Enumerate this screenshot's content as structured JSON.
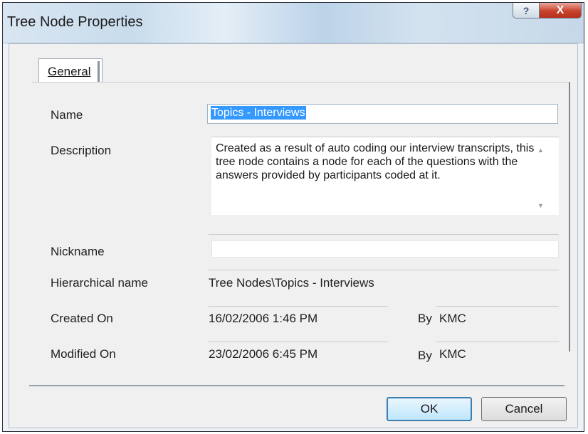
{
  "window": {
    "title": "Tree Node Properties",
    "help_label": "?",
    "close_label": "X"
  },
  "tabs": [
    {
      "label": "General",
      "selected": true
    }
  ],
  "fields": {
    "name": {
      "label": "Name",
      "value": "Topics - Interviews"
    },
    "description": {
      "label": "Description",
      "value": "Created as a result of auto coding our interview transcripts, this tree node contains a node for each of the questions with the answers provided by participants coded at it."
    },
    "nickname": {
      "label": "Nickname",
      "value": ""
    },
    "hierarchical_name": {
      "label": "Hierarchical name",
      "value": "Tree Nodes\\Topics - Interviews"
    },
    "created_on": {
      "label": "Created On",
      "value": "16/02/2006 1:46 PM",
      "by_label": "By",
      "by_value": "KMC"
    },
    "modified_on": {
      "label": "Modified On",
      "value": "23/02/2006 6:45 PM",
      "by_label": "By",
      "by_value": "KMC"
    }
  },
  "buttons": {
    "ok": "OK",
    "cancel": "Cancel"
  },
  "colors": {
    "selection": "#3399ff",
    "close_button": "#c8422c"
  }
}
